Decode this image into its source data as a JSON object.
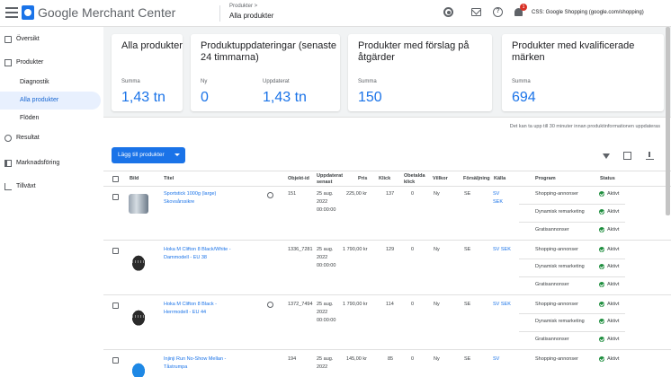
{
  "topbar": {
    "app_name": "Google Merchant Center",
    "breadcrumb_parent": "Produkter >",
    "breadcrumb_current": "Alla produkter",
    "account": "CSS: Google Shopping (google.com/shopping)",
    "notification_count": "1"
  },
  "sidebar": {
    "items": [
      {
        "label": "Översikt",
        "icon": "grid-icon"
      },
      {
        "label": "Produkter",
        "icon": "box-icon"
      },
      {
        "label": "Diagnostik"
      },
      {
        "label": "Alla produkter"
      },
      {
        "label": "Flöden"
      },
      {
        "label": "Resultat",
        "icon": "results-icon"
      },
      {
        "label": "Marknadsföring",
        "icon": "marketing-icon"
      },
      {
        "label": "Tillväxt",
        "icon": "growth-icon"
      }
    ]
  },
  "cards": [
    {
      "title": "Alla produkter",
      "label1": "Summa",
      "value1": "1,43 tn"
    },
    {
      "title": "Produktuppdateringar (senaste 24 timmarna)",
      "label1": "Ny",
      "value1": "0",
      "label2": "Uppdaterat",
      "value2": "1,43 tn"
    },
    {
      "title": "Produkter med förslag på åtgärder",
      "label1": "Summa",
      "value1": "150"
    },
    {
      "title": "Produkter med kvalificerade märken",
      "label1": "Summa",
      "value1": "694"
    }
  ],
  "notice": "Det kan ta upp till 30 minuter innan produktinformationen uppdateras",
  "toolbar": {
    "add_button": "Lägg till produkter"
  },
  "table": {
    "headers": {
      "image": "Bild",
      "title": "Titel",
      "object_id": "Objekt-id",
      "updated": "Uppdaterat senast",
      "price": "Pris",
      "clicks": "Klick",
      "unpaid_clicks": "Obetalda klick",
      "condition": "Villkor",
      "country": "Försäljning",
      "source": "Källa",
      "program": "Program",
      "status": "Status"
    },
    "rows": [
      {
        "title": "Sportstick 1000g (large) Skovsårssikre",
        "object_id": "151",
        "updated": [
          "25 aug.",
          "2022",
          "00:00:00"
        ],
        "price": "225,00 kr",
        "clicks": "137",
        "unpaid": "0",
        "condition": "Ny",
        "country": "SE",
        "source": [
          "SV",
          "SEK"
        ],
        "programs": [
          "Shopping-annonser",
          "Dynamisk remarketing",
          "Gratisannonser"
        ],
        "statuses": [
          "Aktivt",
          "Aktivt",
          "Aktivt"
        ]
      },
      {
        "title": "Hoka M Clifton 8 Black/White - Dammodell - EU 38",
        "object_id": "1336_7281",
        "updated": [
          "25 aug.",
          "2022",
          "00:00:00"
        ],
        "price": "1 790,00 kr",
        "clicks": "129",
        "unpaid": "0",
        "condition": "Ny",
        "country": "SE",
        "source": [
          "SV SEK"
        ],
        "programs": [
          "Shopping-annonser",
          "Dynamisk remarketing",
          "Gratisannonser"
        ],
        "statuses": [
          "Aktivt",
          "Aktivt",
          "Aktivt"
        ]
      },
      {
        "title": "Hoka M Clifton 8 Black - Herrmodell - EU 44",
        "object_id": "1372_7494",
        "updated": [
          "25 aug.",
          "2022",
          "00:00:00"
        ],
        "price": "1 790,00 kr",
        "clicks": "114",
        "unpaid": "0",
        "condition": "Ny",
        "country": "SE",
        "source": [
          "SV SEK"
        ],
        "programs": [
          "Shopping-annonser",
          "Dynamisk remarketing",
          "Gratisannonser"
        ],
        "statuses": [
          "Aktivt",
          "Aktivt",
          "Aktivt"
        ]
      },
      {
        "title": "Injinji Run No-Show Mellan - Tåstrumpa",
        "object_id": "194",
        "updated": [
          "25 aug.",
          "2022"
        ],
        "price": "145,00 kr",
        "clicks": "85",
        "unpaid": "0",
        "condition": "Ny",
        "country": "SE",
        "source": [
          "SV"
        ],
        "programs": [
          "Shopping-annonser"
        ],
        "statuses": [
          "Aktivt"
        ]
      }
    ]
  },
  "colors": {
    "accent": "#1a73e8",
    "active_nav_bg": "#e8f0fe",
    "status_green": "#1e8e3e"
  }
}
